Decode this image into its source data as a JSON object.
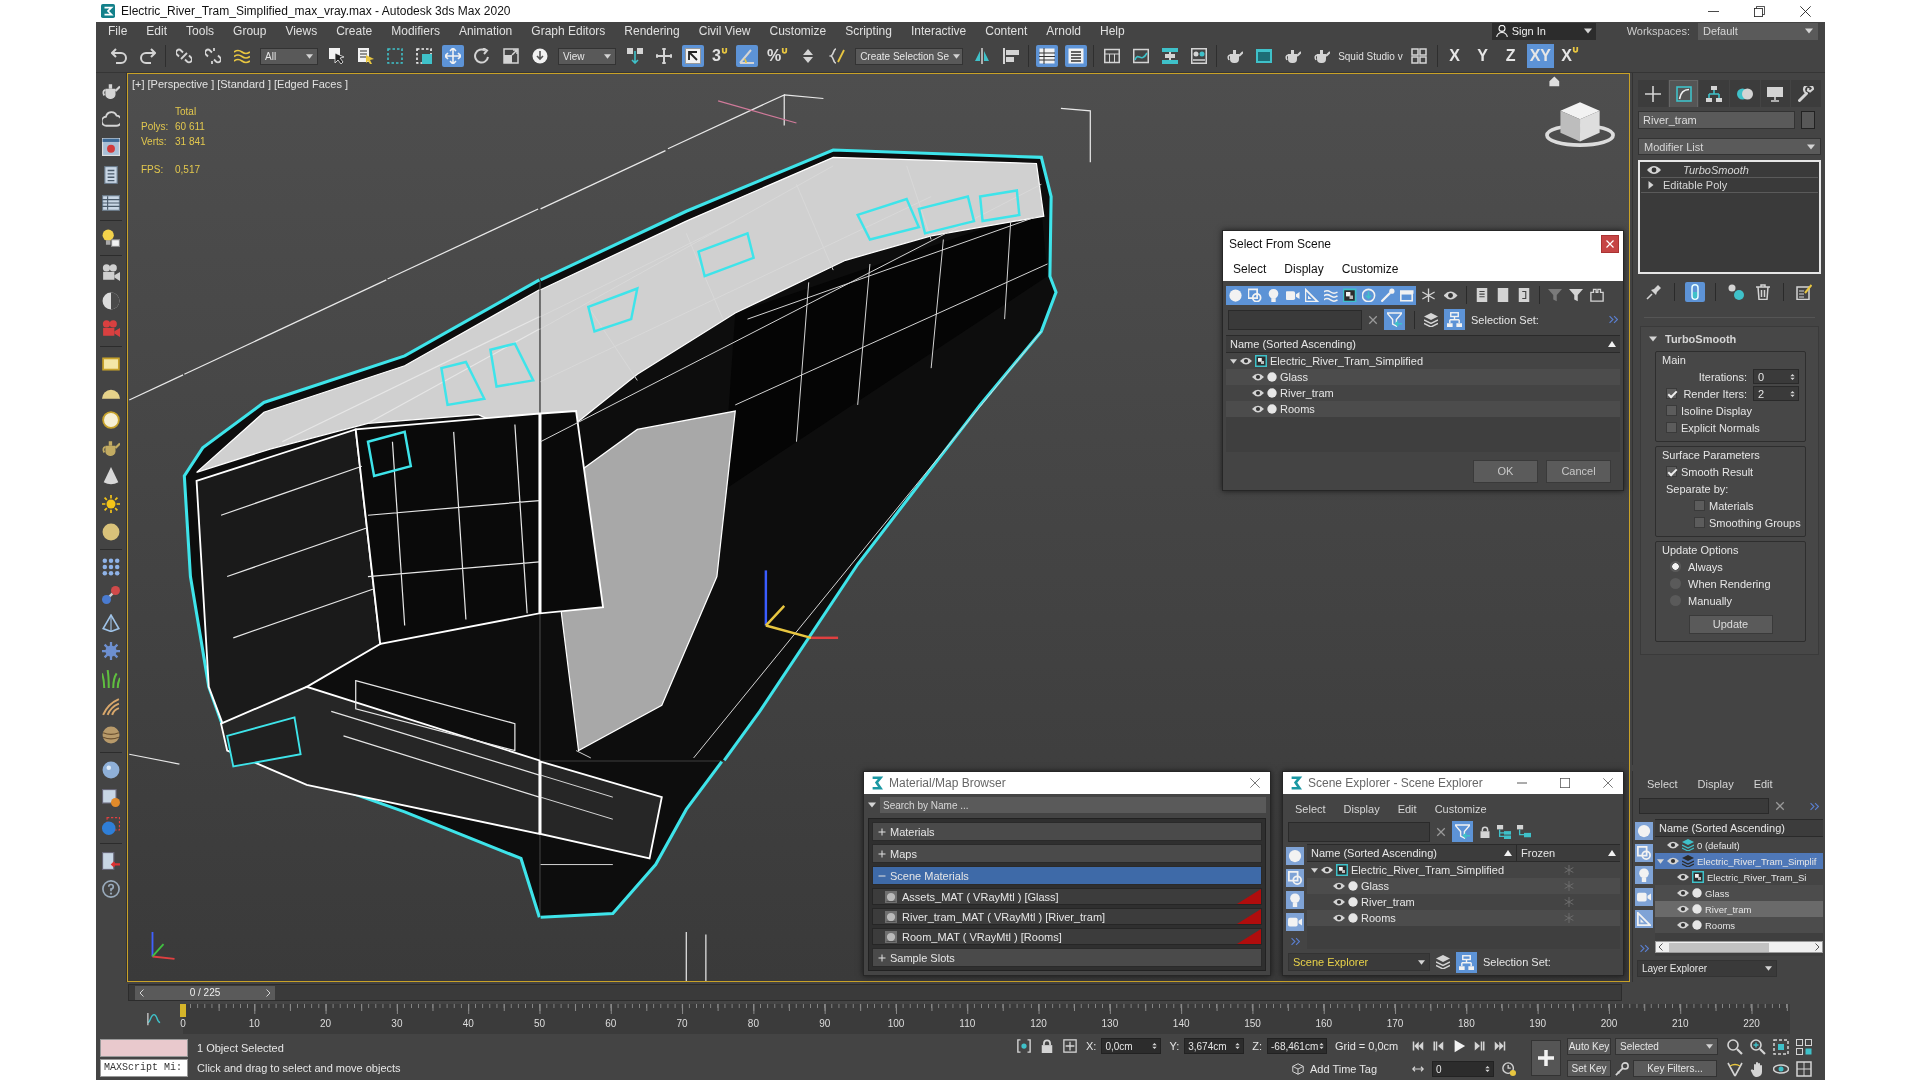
{
  "window": {
    "title": "Electric_River_Tram_Simplified_max_vray.max - Autodesk 3ds Max 2020"
  },
  "menu": [
    "File",
    "Edit",
    "Tools",
    "Group",
    "Views",
    "Create",
    "Modifiers",
    "Animation",
    "Graph Editors",
    "Rendering",
    "Civil View",
    "Customize",
    "Scripting",
    "Interactive",
    "Content",
    "Arnold",
    "Help"
  ],
  "account": {
    "sign_in": "Sign In",
    "workspaces_label": "Workspaces:",
    "workspace": "Default"
  },
  "toolbar": {
    "buttons": [
      {
        "selected": false
      },
      {
        "selected": false
      },
      {
        "selected": false
      },
      {
        "selected": false
      },
      {
        "selected": false
      },
      {
        "selected": false
      },
      {
        "selected": false
      },
      {
        "selected": false
      },
      {
        "selected": false
      },
      {
        "selected": true
      },
      {
        "selected": false
      },
      {
        "selected": false
      },
      {
        "selected": false
      },
      {
        "selected": false
      },
      {
        "selected": false
      },
      {
        "selected": true
      },
      {
        "label": "3",
        "selected": false
      },
      {
        "selected": true
      },
      {
        "label": "%",
        "selected": false
      },
      {
        "selected": false
      },
      {
        "selected": false
      },
      {
        "selected": false
      },
      {
        "selected": false
      },
      {
        "selected": true
      },
      {
        "selected": true
      },
      {
        "selected": false
      },
      {
        "selected": false
      },
      {
        "selected": false
      },
      {
        "selected": false
      },
      {
        "selected": false
      },
      {
        "selected": false
      },
      {
        "selected": false
      },
      {
        "selected": false
      },
      {
        "selected": false
      }
    ],
    "dropdowns": [
      "All",
      "View",
      "Create Selection Se"
    ],
    "plugin": "Squid Studio v",
    "axes": [
      {
        "label": "X",
        "kind": "axis",
        "selected": false
      },
      {
        "label": "Y",
        "kind": "axis",
        "selected": false
      },
      {
        "label": "Z",
        "kind": "axis",
        "selected": false
      },
      {
        "label": "XY",
        "kind": "axis",
        "selected": true
      },
      {
        "label": "X",
        "kind": "snap",
        "selected": false
      }
    ]
  },
  "viewport": {
    "labels": [
      "[+]",
      "[Perspective ]",
      "[Standard ]",
      "[Edged Faces ]"
    ],
    "stats_header": "Total",
    "stats": [
      {
        "label": "Polys:",
        "value": "60 611"
      },
      {
        "label": "Verts:",
        "value": "31 841"
      }
    ],
    "fps_label": "FPS:",
    "fps": "0,517"
  },
  "select_from_scene": {
    "title": "Select From Scene",
    "menu": [
      "Select",
      "Display",
      "Customize"
    ],
    "type_filters": [
      {
        "selected": true
      },
      {
        "selected": true
      },
      {
        "selected": true
      },
      {
        "selected": true
      },
      {
        "selected": true
      },
      {
        "selected": true
      },
      {
        "selected": true
      },
      {
        "selected": true
      },
      {
        "selected": true
      },
      {
        "selected": true
      }
    ],
    "display_filters": [
      {
        "selected": false
      },
      {
        "selected": false
      }
    ],
    "filter_toggle": {
      "selected": true
    },
    "hierarchy_toggle": {
      "selected": true
    },
    "selection_set_label": "Selection Set:",
    "column": "Name (Sorted Ascending)",
    "tree": [
      {
        "name": "Electric_River_Tram_Simplified",
        "kind": "group",
        "selected": false,
        "expanded": true,
        "children": [
          {
            "name": "Glass",
            "kind": "object",
            "selected": false
          },
          {
            "name": "River_tram",
            "kind": "object",
            "selected": false
          },
          {
            "name": "Rooms",
            "kind": "object",
            "selected": false
          }
        ]
      }
    ],
    "buttons": [
      "OK",
      "Cancel"
    ]
  },
  "material_browser": {
    "title": "Material/Map Browser",
    "search": {
      "placeholder": "Search by Name ..."
    },
    "groups": [
      {
        "label": "Materials",
        "expanded": false
      },
      {
        "label": "Maps",
        "expanded": false
      },
      {
        "label": "Scene Materials",
        "expanded": true,
        "items": [
          {
            "name": "Assets_MAT ( VRayMtl ) [Glass]",
            "selected": false
          },
          {
            "name": "River_tram_MAT ( VRayMtl ) [River_tram]",
            "selected": false
          },
          {
            "name": "Room_MAT ( VRayMtl ) [Rooms]",
            "selected": false
          }
        ]
      },
      {
        "label": "Sample Slots",
        "expanded": false
      }
    ]
  },
  "scene_explorer": {
    "title": "Scene Explorer - Scene Explorer",
    "menu": [
      "Select",
      "Display",
      "Edit",
      "Customize"
    ],
    "filter_toggle": {
      "selected": true
    },
    "filters": [
      {
        "selected": true
      },
      {
        "selected": true
      },
      {
        "selected": true
      },
      {
        "selected": true
      }
    ],
    "columns": [
      "Name (Sorted Ascending)",
      "Frozen"
    ],
    "tree": [
      {
        "name": "Electric_River_Tram_Simplified",
        "kind": "group",
        "selected": false,
        "frozen": false,
        "expanded": true,
        "children": [
          {
            "name": "Glass",
            "kind": "object",
            "selected": false,
            "frozen": false
          },
          {
            "name": "River_tram",
            "kind": "object",
            "selected": false,
            "frozen": false
          },
          {
            "name": "Rooms",
            "kind": "object",
            "selected": false,
            "frozen": false
          }
        ]
      }
    ],
    "explorer": "Scene Explorer",
    "hierarchy_toggle": {
      "selected": true
    },
    "selection_set_label": "Selection Set:"
  },
  "command_panel": {
    "tabs": [
      {
        "selected": false
      },
      {
        "selected": true
      },
      {
        "selected": false
      },
      {
        "selected": false
      },
      {
        "selected": false
      },
      {
        "selected": false
      }
    ],
    "object_name": "River_tram",
    "modifier_list": "Modifier List",
    "stack": [
      {
        "name": "TurboSmooth",
        "kind": "modifier",
        "enabled": true,
        "selected": false
      },
      {
        "name": "Editable Poly",
        "kind": "object",
        "expanded": false,
        "selected": false
      }
    ],
    "stack_tools": [
      {
        "selected": false
      },
      {
        "selected": true
      },
      {
        "selected": false
      },
      {
        "selected": false
      },
      {
        "selected": false
      }
    ],
    "rollout": {
      "title": "TurboSmooth",
      "expanded": true,
      "groups": [
        {
          "title": "Main",
          "controls": [
            {
              "kind": "spinner",
              "label": "Iterations:",
              "value": "0"
            },
            {
              "kind": "check_spinner",
              "label": "Render Iters:",
              "value": "2",
              "checked": true
            },
            {
              "kind": "checkbox",
              "label": "Isoline Display",
              "checked": false
            },
            {
              "kind": "checkbox",
              "label": "Explicit Normals",
              "checked": false
            }
          ]
        },
        {
          "title": "Surface Parameters",
          "controls": [
            {
              "kind": "checkbox",
              "label": "Smooth Result",
              "checked": true
            },
            {
              "kind": "label",
              "label": "Separate by:",
              "children": [
                {
                  "kind": "checkbox",
                  "label": "Materials",
                  "checked": false
                },
                {
                  "kind": "checkbox",
                  "label": "Smoothing Groups",
                  "checked": false
                }
              ]
            }
          ]
        },
        {
          "title": "Update Options",
          "controls": [
            {
              "kind": "radio",
              "label": "Always",
              "selected": true
            },
            {
              "kind": "radio",
              "label": "When Rendering",
              "selected": false
            },
            {
              "kind": "radio",
              "label": "Manually",
              "selected": false
            },
            {
              "kind": "button",
              "label": "Update"
            }
          ]
        }
      ]
    }
  },
  "layer_explorer": {
    "menu": [
      "Select",
      "Display",
      "Edit"
    ],
    "filters": [
      {
        "selected": true
      },
      {
        "selected": true
      },
      {
        "selected": true
      },
      {
        "selected": true
      },
      {
        "selected": true
      }
    ],
    "column": "Name (Sorted Ascending)",
    "tree": [
      {
        "name": "0 (default)",
        "kind": "layer",
        "current": true,
        "selected": false
      },
      {
        "name": "Electric_River_Tram_Simplif",
        "kind": "layer",
        "current": false,
        "selected": true,
        "expanded": true,
        "children": [
          {
            "name": "Electric_River_Tram_Si",
            "kind": "group",
            "selected": false
          },
          {
            "name": "Glass",
            "kind": "object",
            "selected": false
          },
          {
            "name": "River_tram",
            "kind": "object",
            "selected": true
          },
          {
            "name": "Rooms",
            "kind": "object",
            "selected": false
          }
        ]
      }
    ],
    "explorer": "Layer Explorer"
  },
  "timeline": {
    "position": "0 / 225",
    "level": 0,
    "ticks": [
      "0",
      "10",
      "20",
      "30",
      "40",
      "50",
      "60",
      "70",
      "80",
      "90",
      "100",
      "110",
      "120",
      "130",
      "140",
      "150",
      "160",
      "170",
      "180",
      "190",
      "200",
      "210",
      "220"
    ]
  },
  "status": {
    "maxscript": "MAXScript Mi:",
    "selection": "1 Object Selected",
    "prompt": "Click and drag to select and move objects",
    "coords": [
      {
        "axis": "X:",
        "value": "0,0cm"
      },
      {
        "axis": "Y:",
        "value": "3,674cm"
      },
      {
        "axis": "Z:",
        "value": "-68,461cm"
      }
    ],
    "grid": "Grid = 0,0cm",
    "time_tag": "Add Time Tag",
    "frame": "0",
    "auto_key": "Auto Key",
    "key_set": "Selected",
    "set_key": "Set Key",
    "key_filters": "Key Filters..."
  }
}
